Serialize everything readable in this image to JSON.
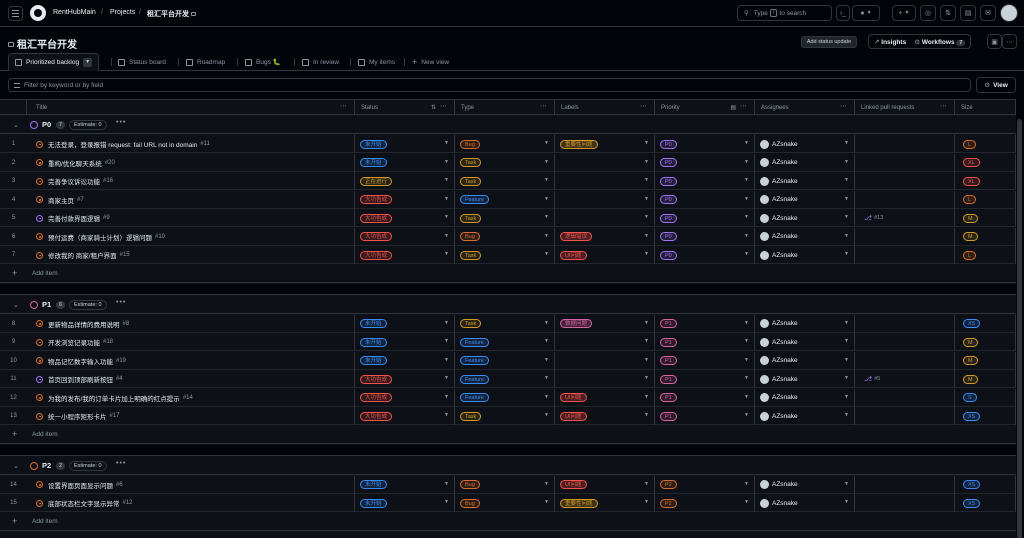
{
  "topbar": {
    "repo": "RentHubMain",
    "sep1": "/",
    "projects": "Projects",
    "sep2": "/",
    "project": "租汇平台开发",
    "search_pre": "Type",
    "search_key": "/",
    "search_post": "to search"
  },
  "header": {
    "title": "租汇平台开发",
    "add_status_update": "Add status update",
    "insights": "Insights",
    "workflows": "Workflows",
    "workflows_count": "7"
  },
  "tabs": [
    {
      "label": "Prioritized backlog"
    },
    {
      "label": "Status board"
    },
    {
      "label": "Roadmap"
    },
    {
      "label": "Bugs 🐛"
    },
    {
      "label": "In review"
    },
    {
      "label": "My items"
    },
    {
      "label": "New view"
    }
  ],
  "filter": {
    "placeholder": "Filter by keyword or by field",
    "view_label": "View"
  },
  "columns": {
    "title": "Title",
    "status": "Status",
    "type": "Type",
    "labels": "Labels",
    "priority": "Priority",
    "assignees": "Assignees",
    "linked_prs": "Linked pull requests",
    "size": "Size"
  },
  "colors": {
    "status_todo": "#388bfd",
    "status_inprogress": "#d29922",
    "status_done": "#f85149",
    "type_bug": "#db6d28",
    "type_task": "#d29922",
    "type_feature": "#388bfd",
    "label_yellow": "#d29922",
    "label_red": "#f85149",
    "label_pink": "#db61a2",
    "p0": "#a371f7",
    "p1": "#db61a2",
    "p2": "#db6d28"
  },
  "groups": [
    {
      "name": "P0",
      "count": "7",
      "estimate": "Estimate: 0",
      "dots": "•••",
      "circle_color": "#a371f7",
      "add_label": "Add item",
      "rows": [
        {
          "num": "1",
          "title": "无法登录，登录报错 request: fail URL not in domain",
          "issue": "#11",
          "icon_color": "#db6d28",
          "status": "未开始",
          "status_kind": "todo",
          "type": "Bug",
          "type_kind": "bug",
          "label": "重要性问题",
          "label_kind": "yellow",
          "priority": "P0",
          "assignee": "AZsnake",
          "pr": "",
          "size": "L"
        },
        {
          "num": "2",
          "title": "重构/优化聊天系统",
          "issue": "#20",
          "icon_color": "#db6d28",
          "status": "未开始",
          "status_kind": "todo",
          "type": "Task",
          "type_kind": "task",
          "label": "",
          "label_kind": "",
          "priority": "P0",
          "assignee": "AZsnake",
          "pr": "",
          "size": "XL"
        },
        {
          "num": "3",
          "title": "完善争议诉讼功能",
          "issue": "#16",
          "icon_color": "#db6d28",
          "status": "正在进行",
          "status_kind": "inprogress",
          "type": "Task",
          "type_kind": "task",
          "label": "",
          "label_kind": "",
          "priority": "P0",
          "assignee": "AZsnake",
          "pr": "",
          "size": "XL"
        },
        {
          "num": "4",
          "title": "商家主页",
          "issue": "#7",
          "icon_color": "#db6d28",
          "status": "大功告成",
          "status_kind": "done",
          "type": "Feature",
          "type_kind": "feature",
          "label": "",
          "label_kind": "",
          "priority": "P0",
          "assignee": "AZsnake",
          "pr": "",
          "size": "L"
        },
        {
          "num": "5",
          "title": "完善付款界面逻辑",
          "issue": "#9",
          "icon_color": "#a371f7",
          "status": "大功告成",
          "status_kind": "done",
          "type": "Task",
          "type_kind": "task",
          "label": "",
          "label_kind": "",
          "priority": "P0",
          "assignee": "AZsnake",
          "pr": "#13",
          "size": "M"
        },
        {
          "num": "6",
          "title": "预付运费（商家骑士计划）逻辑问题",
          "issue": "#10",
          "icon_color": "#db6d28",
          "status": "大功告成",
          "status_kind": "done",
          "type": "Bug",
          "type_kind": "bug",
          "label": "逻辑错误",
          "label_kind": "red",
          "priority": "P0",
          "assignee": "AZsnake",
          "pr": "",
          "size": "M"
        },
        {
          "num": "7",
          "title": "修改我的 商家/租户界面",
          "issue": "#15",
          "icon_color": "#db6d28",
          "status": "大功告成",
          "status_kind": "done",
          "type": "Task",
          "type_kind": "task",
          "label": "UI问题",
          "label_kind": "red",
          "priority": "P0",
          "assignee": "AZsnake",
          "pr": "",
          "size": "L"
        }
      ]
    },
    {
      "name": "P1",
      "count": "6",
      "estimate": "Estimate: 0",
      "dots": "•••",
      "circle_color": "#db61a2",
      "add_label": "Add item",
      "rows": [
        {
          "num": "8",
          "title": "更新物品详情的费用说明",
          "issue": "#8",
          "icon_color": "#db6d28",
          "status": "未开始",
          "status_kind": "todo",
          "type": "Task",
          "type_kind": "task",
          "label": "数据问题",
          "label_kind": "pink",
          "priority": "P1",
          "assignee": "AZsnake",
          "pr": "",
          "size": "XS"
        },
        {
          "num": "9",
          "title": "开发浏览记录功能",
          "issue": "#18",
          "icon_color": "#db6d28",
          "status": "未开始",
          "status_kind": "todo",
          "type": "Feature",
          "type_kind": "feature",
          "label": "",
          "label_kind": "",
          "priority": "P1",
          "assignee": "AZsnake",
          "pr": "",
          "size": "M"
        },
        {
          "num": "10",
          "title": "物品记忆数字输入功能",
          "issue": "#19",
          "icon_color": "#db6d28",
          "status": "未开始",
          "status_kind": "todo",
          "type": "Feature",
          "type_kind": "feature",
          "label": "",
          "label_kind": "",
          "priority": "P1",
          "assignee": "AZsnake",
          "pr": "",
          "size": "M"
        },
        {
          "num": "11",
          "title": "首页回到顶部刷新按钮",
          "issue": "#4",
          "icon_color": "#a371f7",
          "status": "大功告成",
          "status_kind": "done",
          "type": "Feature",
          "type_kind": "feature",
          "label": "",
          "label_kind": "",
          "priority": "P1",
          "assignee": "AZsnake",
          "pr": "#5",
          "size": "M"
        },
        {
          "num": "12",
          "title": "为我的发布/我的订单卡片加上明确的红点提示",
          "issue": "#14",
          "icon_color": "#db6d28",
          "status": "大功告成",
          "status_kind": "done",
          "type": "Feature",
          "type_kind": "feature",
          "label": "UI问题",
          "label_kind": "red",
          "priority": "P1",
          "assignee": "AZsnake",
          "pr": "",
          "size": "S"
        },
        {
          "num": "13",
          "title": "统一小程序矩形卡片",
          "issue": "#17",
          "icon_color": "#db6d28",
          "status": "大功告成",
          "status_kind": "done",
          "type": "Task",
          "type_kind": "task",
          "label": "UI问题",
          "label_kind": "red",
          "priority": "P1",
          "assignee": "AZsnake",
          "pr": "",
          "size": "XS"
        }
      ]
    },
    {
      "name": "P2",
      "count": "2",
      "estimate": "Estimate: 0",
      "dots": "•••",
      "circle_color": "#db6d28",
      "add_label": "Add item",
      "rows": [
        {
          "num": "14",
          "title": "设置界面页面显示问题",
          "issue": "#6",
          "icon_color": "#db6d28",
          "status": "未开始",
          "status_kind": "todo",
          "type": "Bug",
          "type_kind": "bug",
          "label": "UI问题",
          "label_kind": "red",
          "priority": "P2",
          "assignee": "AZsnake",
          "pr": "",
          "size": "XS"
        },
        {
          "num": "15",
          "title": "底部状态栏文字显示异常",
          "issue": "#12",
          "icon_color": "#db6d28",
          "status": "未开始",
          "status_kind": "todo",
          "type": "Bug",
          "type_kind": "bug",
          "label": "重要性问题",
          "label_kind": "yellow",
          "priority": "P2",
          "assignee": "AZsnake",
          "pr": "",
          "size": "XS"
        }
      ]
    }
  ]
}
